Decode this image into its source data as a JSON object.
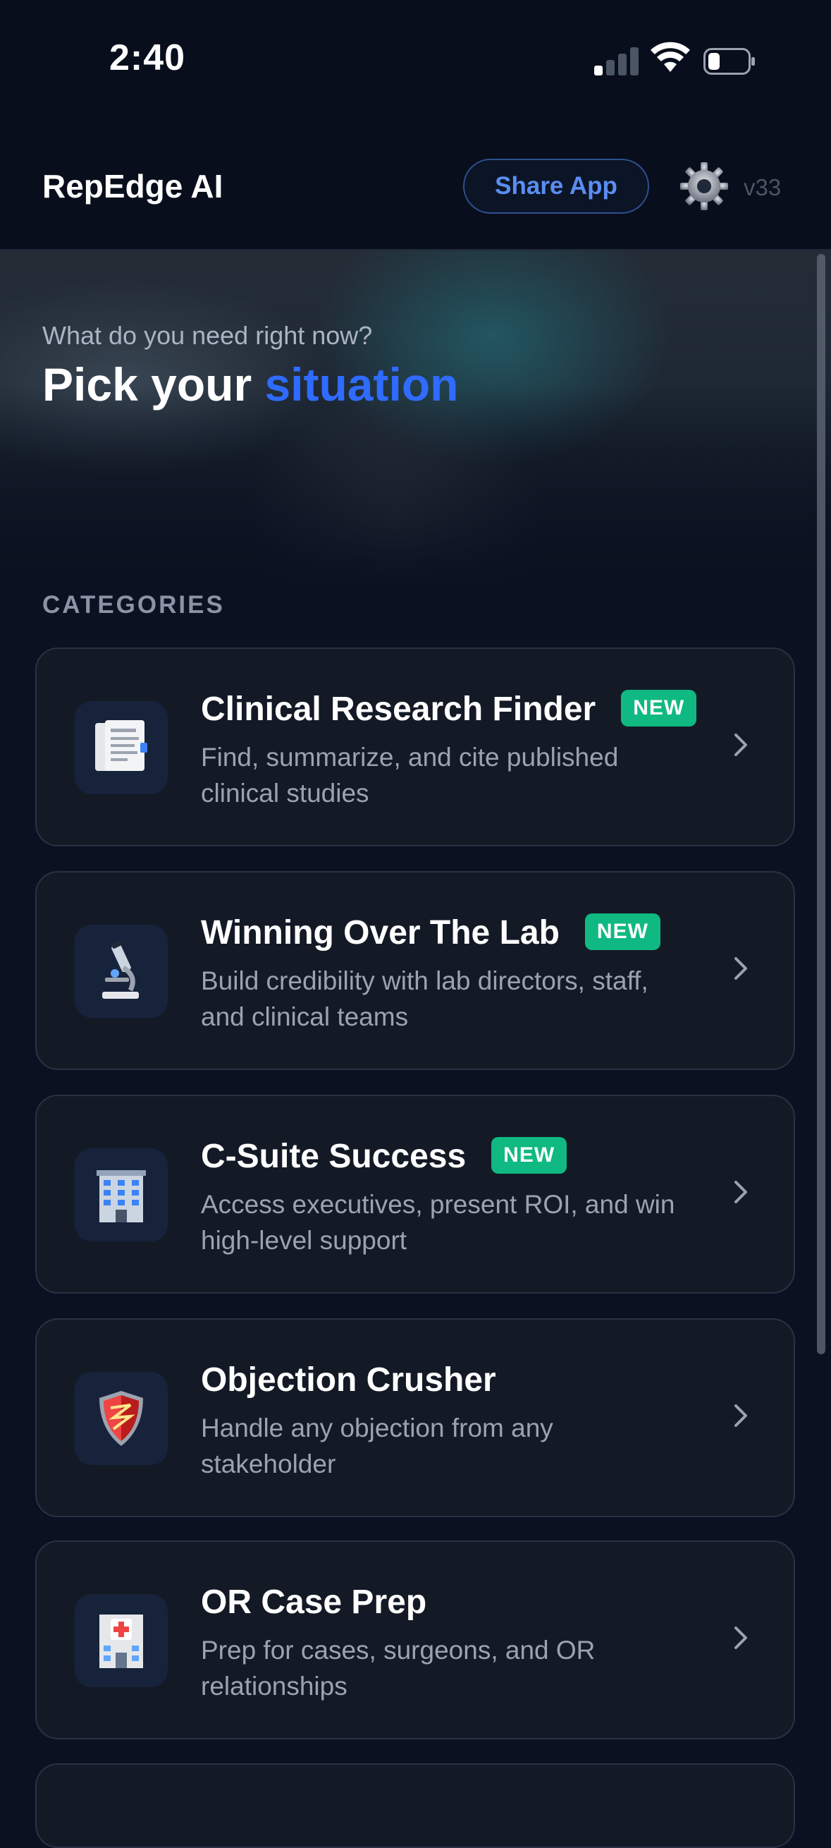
{
  "status_bar": {
    "time": "2:40"
  },
  "header": {
    "title": "RepEdge AI",
    "share_label": "Share App",
    "version": "v33"
  },
  "hero": {
    "subtitle": "What do you need right now?",
    "title_prefix": "Pick your ",
    "title_accent": "situation"
  },
  "section_label": "CATEGORIES",
  "categories": [
    {
      "title": "Clinical Research Finder",
      "badge": "NEW",
      "description": "Find, summarize, and cite published clinical studies",
      "icon": "document-icon"
    },
    {
      "title": "Winning Over The Lab",
      "badge": "NEW",
      "description": "Build credibility with lab directors, staff, and clinical teams",
      "icon": "microscope-icon"
    },
    {
      "title": "C-Suite Success",
      "badge": "NEW",
      "description": "Access executives, present ROI, and win high-level support",
      "icon": "office-building-icon"
    },
    {
      "title": "Objection Crusher",
      "badge": "",
      "description": "Handle any objection from any stakeholder",
      "icon": "shield-icon"
    },
    {
      "title": "OR Case Prep",
      "badge": "",
      "description": "Prep for cases, surgeons, and OR relationships",
      "icon": "hospital-icon"
    }
  ],
  "colors": {
    "accent": "#2f6bff",
    "badge": "#10b981",
    "background": "#0b1120",
    "card": "#131a26"
  }
}
